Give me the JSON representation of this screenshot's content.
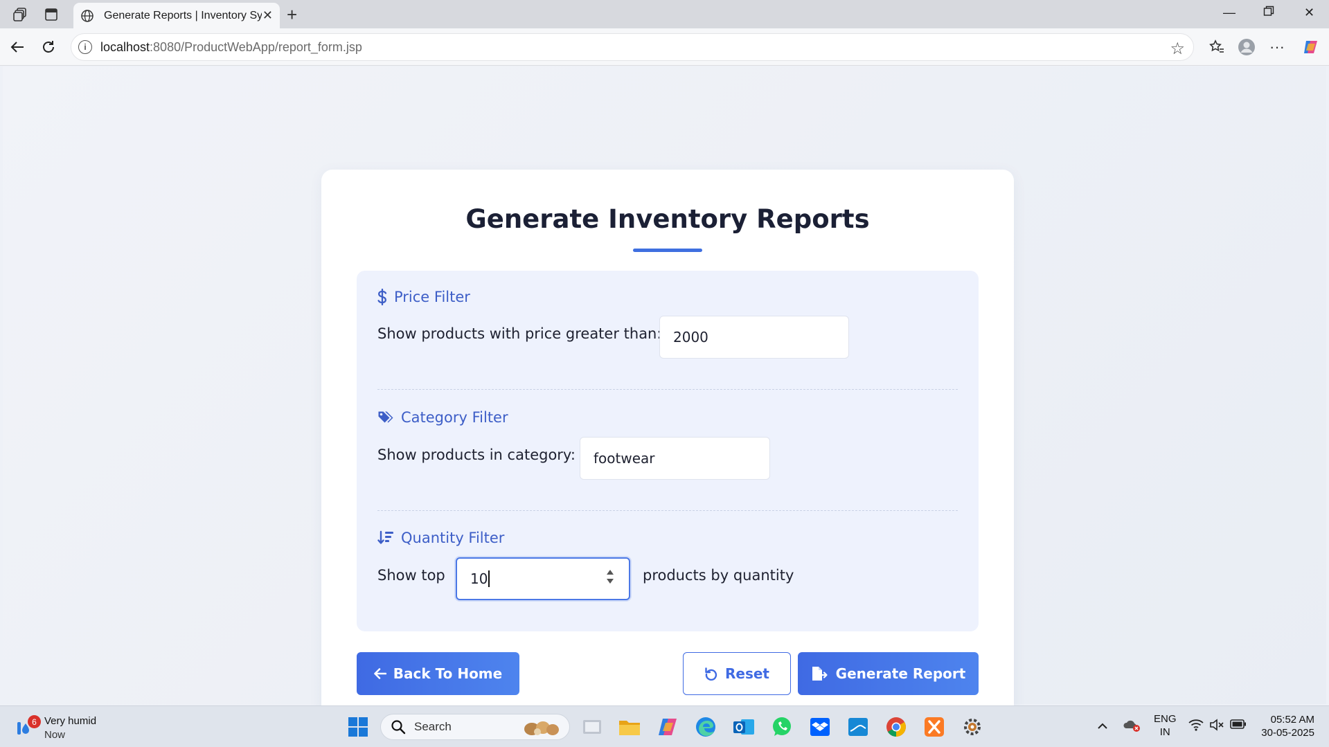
{
  "browser": {
    "tab_title": "Generate Reports | Inventory Syst",
    "url_host": "localhost",
    "url_rest": ":8080/ProductWebApp/report_form.jsp"
  },
  "page": {
    "title": "Generate Inventory Reports",
    "accent_color": "#3f6fe0",
    "price_filter": {
      "heading": "Price Filter",
      "label": "Show products with price greater than:",
      "value": "2000"
    },
    "category_filter": {
      "heading": "Category Filter",
      "label": "Show products in category:",
      "value": "footwear"
    },
    "quantity_filter": {
      "heading": "Quantity Filter",
      "label_before": "Show top",
      "value": "10",
      "label_after": "products by quantity"
    },
    "buttons": {
      "back": "Back To Home",
      "reset": "Reset",
      "generate": "Generate Report"
    }
  },
  "taskbar": {
    "weather_badge": "6",
    "weather_title": "Very humid",
    "weather_sub": "Now",
    "search_placeholder": "Search",
    "lang_top": "ENG",
    "lang_bottom": "IN",
    "time": "05:52 AM",
    "date": "30-05-2025"
  }
}
